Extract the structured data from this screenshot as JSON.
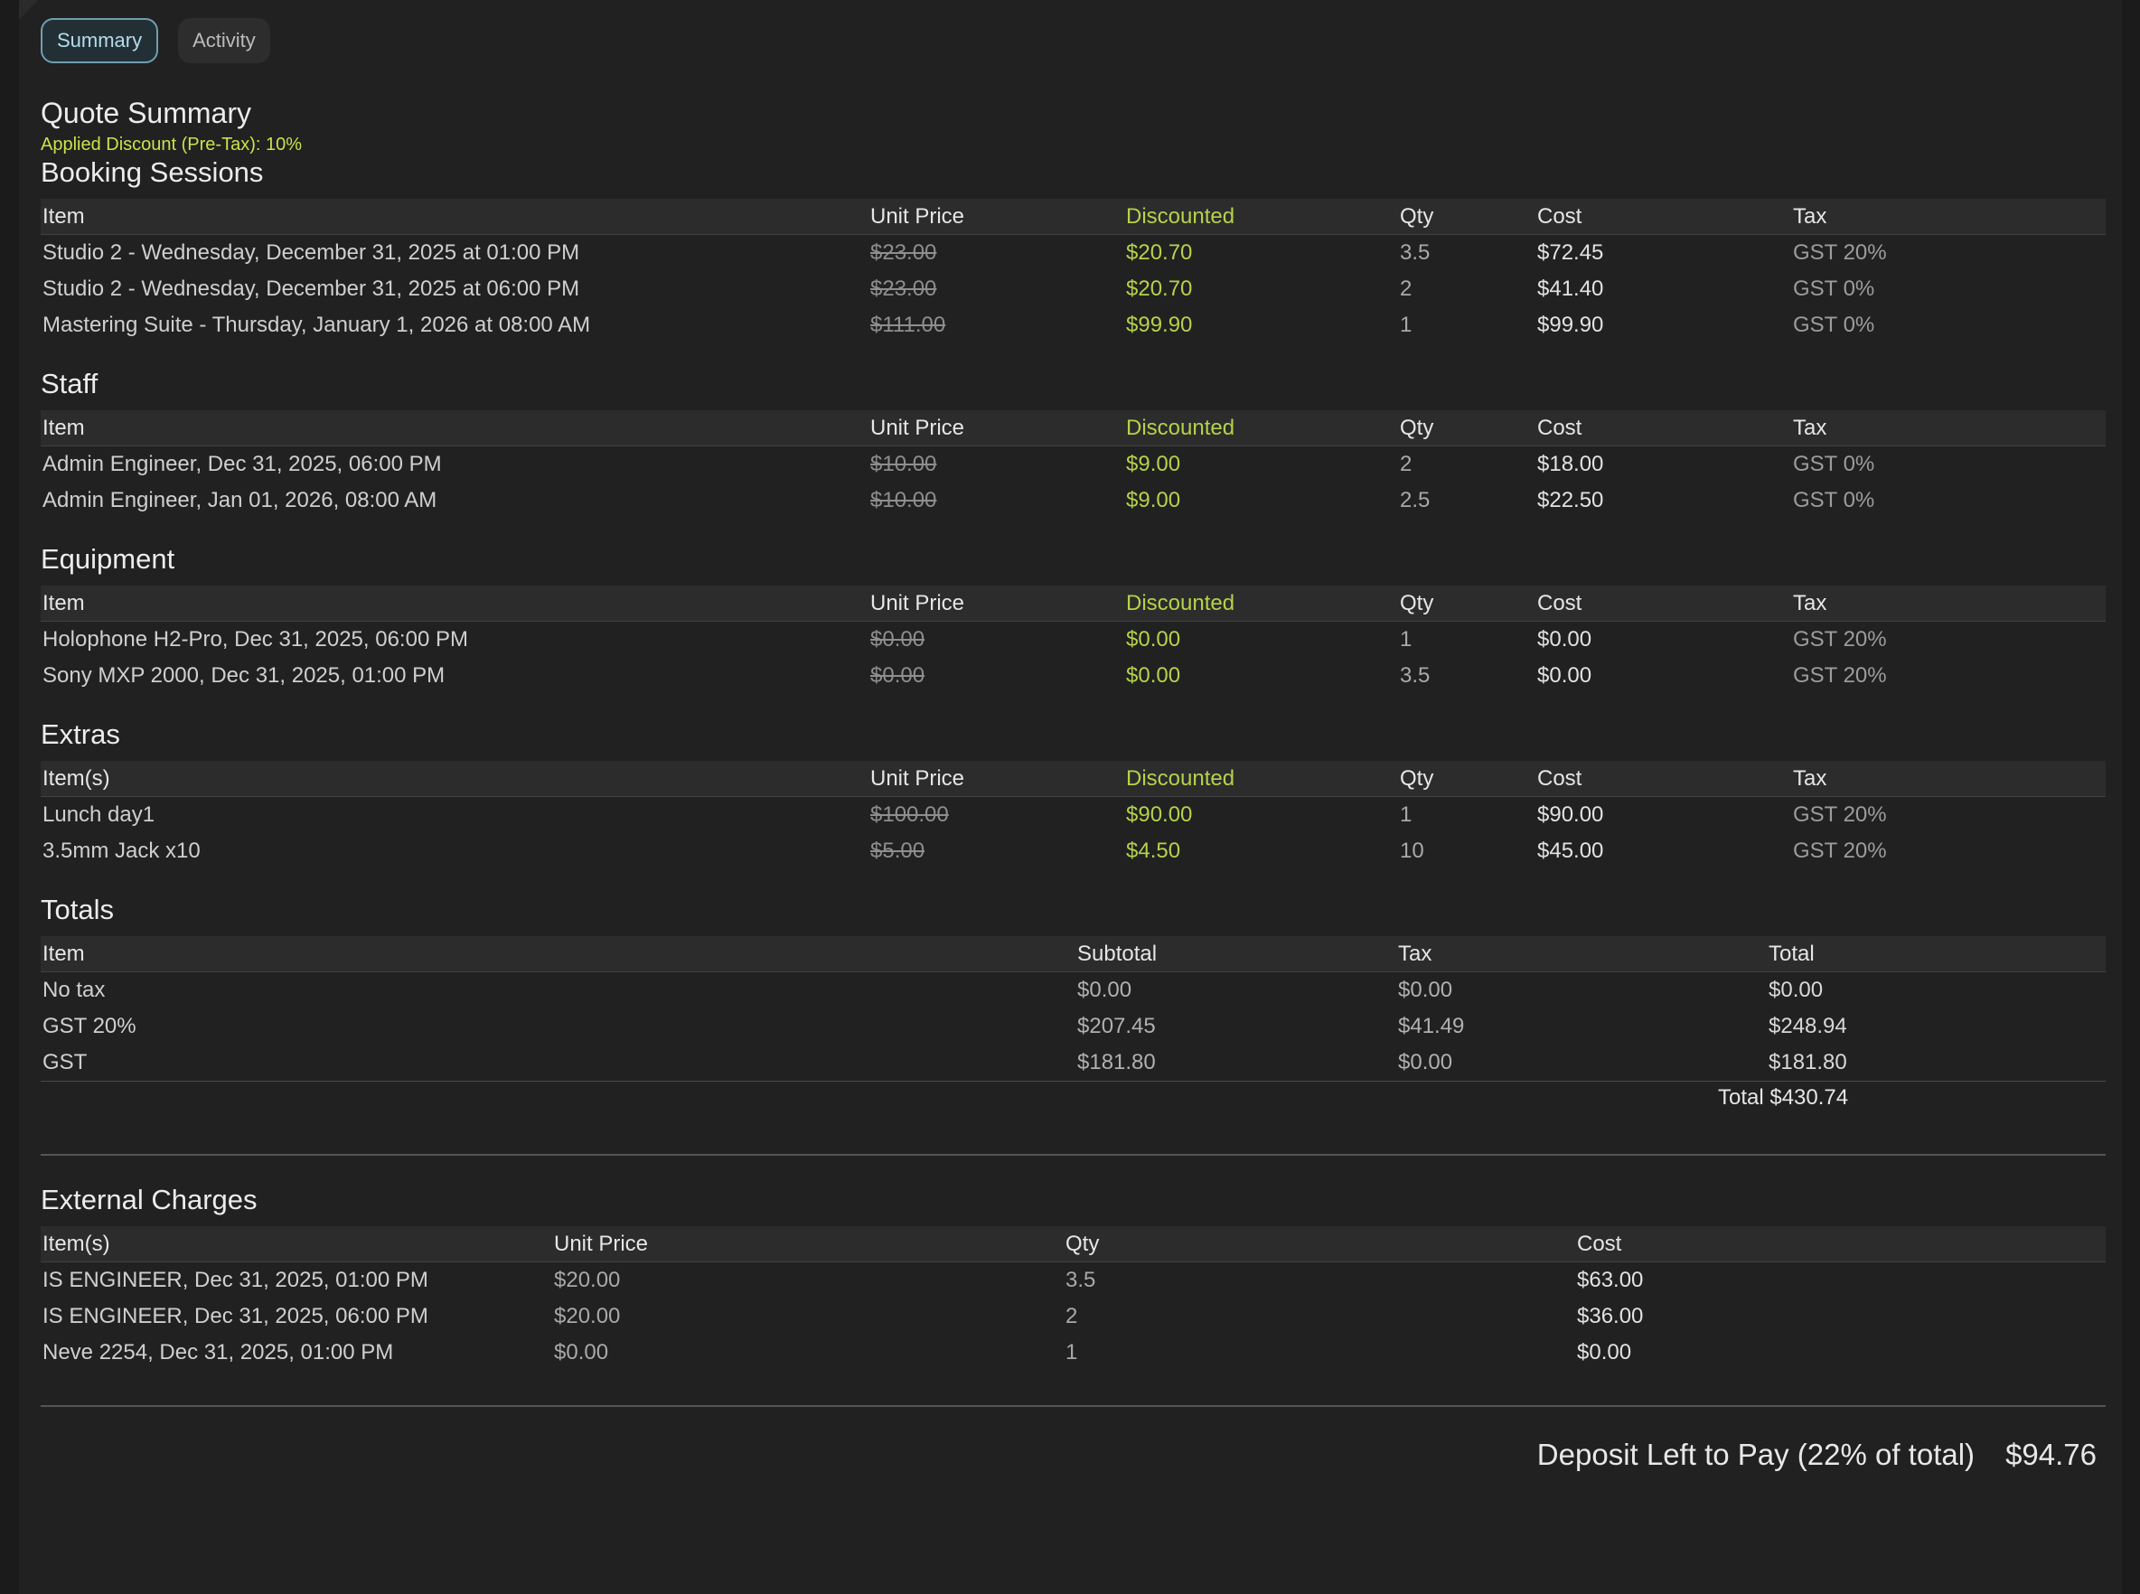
{
  "tabs": [
    {
      "label": "Summary"
    },
    {
      "label": "Activity"
    }
  ],
  "title": "Quote Summary",
  "discount_text": "Applied Discount (Pre-Tax): 10%",
  "item_sections": [
    {
      "title": "Booking Sessions",
      "headers": [
        "Item",
        "Unit Price",
        "Discounted",
        "Qty",
        "Cost",
        "Tax"
      ],
      "rows": [
        [
          "Studio 2 - Wednesday, December 31, 2025 at 01:00 PM",
          "$23.00",
          "$20.70",
          "3.5",
          "$72.45",
          "GST 20%"
        ],
        [
          "Studio 2 - Wednesday, December 31, 2025 at 06:00 PM",
          "$23.00",
          "$20.70",
          "2",
          "$41.40",
          "GST 0%"
        ],
        [
          "Mastering Suite - Thursday, January 1, 2026 at 08:00 AM",
          "$111.00",
          "$99.90",
          "1",
          "$99.90",
          "GST 0%"
        ]
      ]
    },
    {
      "title": "Staff",
      "headers": [
        "Item",
        "Unit Price",
        "Discounted",
        "Qty",
        "Cost",
        "Tax"
      ],
      "rows": [
        [
          "Admin Engineer, Dec 31, 2025, 06:00 PM",
          "$10.00",
          "$9.00",
          "2",
          "$18.00",
          "GST 0%"
        ],
        [
          "Admin Engineer, Jan 01, 2026, 08:00 AM",
          "$10.00",
          "$9.00",
          "2.5",
          "$22.50",
          "GST 0%"
        ]
      ]
    },
    {
      "title": "Equipment",
      "headers": [
        "Item",
        "Unit Price",
        "Discounted",
        "Qty",
        "Cost",
        "Tax"
      ],
      "rows": [
        [
          "Holophone H2-Pro, Dec 31, 2025, 06:00 PM",
          "$0.00",
          "$0.00",
          "1",
          "$0.00",
          "GST 20%"
        ],
        [
          "Sony MXP 2000, Dec 31, 2025, 01:00 PM",
          "$0.00",
          "$0.00",
          "3.5",
          "$0.00",
          "GST 20%"
        ]
      ]
    },
    {
      "title": "Extras",
      "headers": [
        "Item(s)",
        "Unit Price",
        "Discounted",
        "Qty",
        "Cost",
        "Tax"
      ],
      "rows": [
        [
          "Lunch day1",
          "$100.00",
          "$90.00",
          "1",
          "$90.00",
          "GST 20%"
        ],
        [
          "3.5mm Jack x10",
          "$5.00",
          "$4.50",
          "10",
          "$45.00",
          "GST 20%"
        ]
      ]
    }
  ],
  "totals": {
    "title": "Totals",
    "headers": [
      "Item",
      "Subtotal",
      "Tax",
      "Total"
    ],
    "rows": [
      [
        "No tax",
        "$0.00",
        "$0.00",
        "$0.00"
      ],
      [
        "GST 20%",
        "$207.45",
        "$41.49",
        "$248.94"
      ],
      [
        "GST",
        "$181.80",
        "$0.00",
        "$181.80"
      ]
    ],
    "grand_total": "Total $430.74"
  },
  "external": {
    "title": "External Charges",
    "headers": [
      "Item(s)",
      "Unit Price",
      "Qty",
      "Cost"
    ],
    "rows": [
      [
        "IS ENGINEER, Dec 31, 2025, 01:00 PM",
        "$20.00",
        "3.5",
        "$63.00"
      ],
      [
        "IS ENGINEER, Dec 31, 2025, 06:00 PM",
        "$20.00",
        "2",
        "$36.00"
      ],
      [
        "Neve 2254, Dec 31, 2025, 01:00 PM",
        "$0.00",
        "1",
        "$0.00"
      ]
    ]
  },
  "deposit": {
    "label": "Deposit Left to Pay (22% of total)",
    "amount": "$94.76"
  },
  "colors": {
    "accent_green": "#b5d24a",
    "discount_text": "#c9e24a",
    "active_tab_border": "#6f9eaf",
    "background": "#212121"
  }
}
